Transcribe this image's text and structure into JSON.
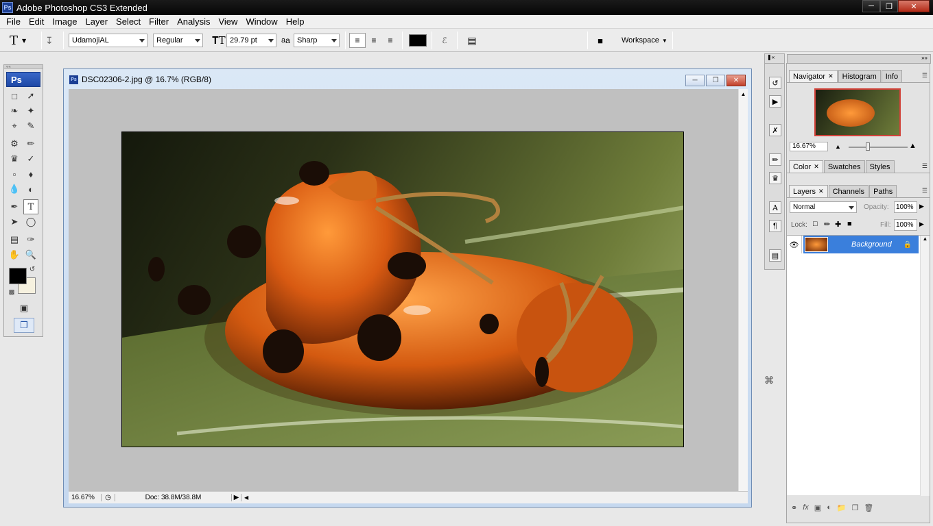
{
  "app": {
    "title": "Adobe Photoshop CS3 Extended",
    "logo": "Ps"
  },
  "menu": [
    "File",
    "Edit",
    "Image",
    "Layer",
    "Select",
    "Filter",
    "Analysis",
    "View",
    "Window",
    "Help"
  ],
  "options": {
    "tool_glyph": "T",
    "font_family": "UdamojiAL",
    "font_style": "Regular",
    "font_size": "29.79 pt",
    "aa_label": "a",
    "aa_prefix": "a",
    "antialias": "Sharp",
    "color": "#000000",
    "workspace": "Workspace"
  },
  "toolbox": {
    "logo": "Ps",
    "fg_color": "#000000",
    "bg_color": "#f6f1df"
  },
  "document": {
    "title": "DSC02306-2.jpg @ 16.7% (RGB/8)",
    "zoom": "16.67%",
    "doc_size": "Doc: 38.8M/38.8M"
  },
  "navigator": {
    "tabs": [
      "Navigator",
      "Histogram",
      "Info"
    ],
    "zoom": "16.67%"
  },
  "color_panel": {
    "tabs": [
      "Color",
      "Swatches",
      "Styles"
    ]
  },
  "layers_panel": {
    "tabs": [
      "Layers",
      "Channels",
      "Paths"
    ],
    "blend_mode": "Normal",
    "opacity_label": "Opacity:",
    "opacity": "100%",
    "lock_label": "Lock:",
    "fill_label": "Fill:",
    "fill": "100%",
    "layers": [
      {
        "name": "Background",
        "selected": true
      }
    ]
  },
  "colors": {
    "selection": "#3a7fdc",
    "accent": "#1c3f94"
  }
}
